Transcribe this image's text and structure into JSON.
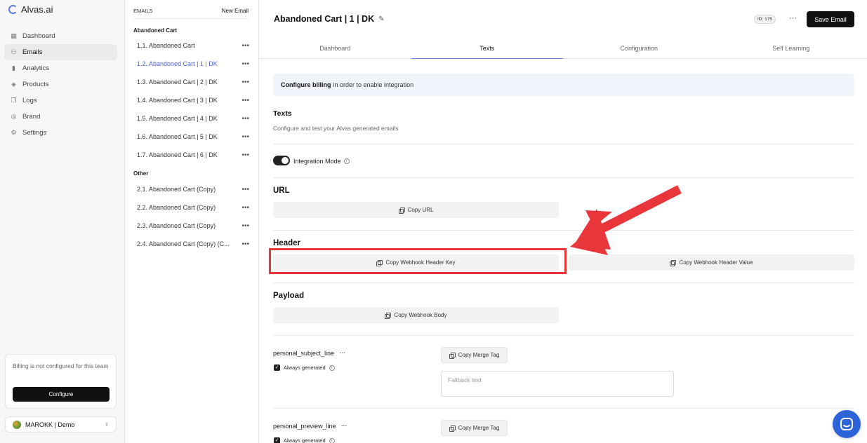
{
  "app": {
    "name": "Alvas.ai"
  },
  "sidebar": {
    "items": [
      {
        "label": "Dashboard",
        "icon": "grid-icon"
      },
      {
        "label": "Emails",
        "icon": "mail-icon",
        "active": true
      },
      {
        "label": "Analytics",
        "icon": "bar-chart-icon"
      },
      {
        "label": "Products",
        "icon": "box-icon"
      },
      {
        "label": "Logs",
        "icon": "logs-icon"
      },
      {
        "label": "Brand",
        "icon": "palette-icon"
      },
      {
        "label": "Settings",
        "icon": "gear-icon"
      }
    ],
    "billing_text": "Billing is not configured for this team",
    "configure_label": "Configure",
    "team_name": "MAROKK | Demo"
  },
  "emails": {
    "header": "EMAILS",
    "new_label": "New Email",
    "groups": [
      {
        "title": "Abandoned Cart",
        "items": [
          "1.1. Abandoned Cart",
          "1.2. Abandoned Cart | 1 | DK",
          "1.3. Abandoned Cart | 2 | DK",
          "1.4. Abandoned Cart | 3 | DK",
          "1.5. Abandoned Cart | 4 | DK",
          "1.6. Abandoned Cart | 5 | DK",
          "1.7. Abandoned Cart | 6 | DK"
        ]
      },
      {
        "title": "Other",
        "items": [
          "2.1. Abandoned Cart (Copy)",
          "2.2. Abandoned Cart (Copy)",
          "2.3. Abandoned Cart (Copy)",
          "2.4. Abandoned Cart (Copy) (C..."
        ]
      }
    ],
    "more_glyph": "•••"
  },
  "main": {
    "title": "Abandoned Cart | 1 | DK",
    "id_badge": "ID: 175",
    "more_glyph": "···",
    "save_label": "Save Email",
    "tabs": [
      "Dashboard",
      "Texts",
      "Configuration",
      "Self Learning"
    ],
    "banner_bold": "Configure billing",
    "banner_rest": "in order to enable integration",
    "texts_title": "Texts",
    "texts_sub": "Configure and test your Alvas generated emails",
    "integration_label": "Integration Mode",
    "url_title": "URL",
    "copy_url": "Copy URL",
    "header_title": "Header",
    "copy_header_key": "Copy Webhook Header Key",
    "copy_header_value": "Copy Webhook Header Value",
    "payload_title": "Payload",
    "copy_body": "Copy Webhook Body",
    "fields": [
      {
        "name": "personal_subject_line",
        "always": "Always generated",
        "merge": "Copy Merge Tag",
        "fallback_placeholder": "Fallback text"
      },
      {
        "name": "personal_preview_line",
        "always": "Always generated",
        "merge": "Copy Merge Tag"
      }
    ],
    "info_glyph": "i",
    "check_glyph": "✓"
  },
  "colors": {
    "accent": "#4a5fd6",
    "annotation": "#e8363a",
    "help": "#2d63d8"
  }
}
